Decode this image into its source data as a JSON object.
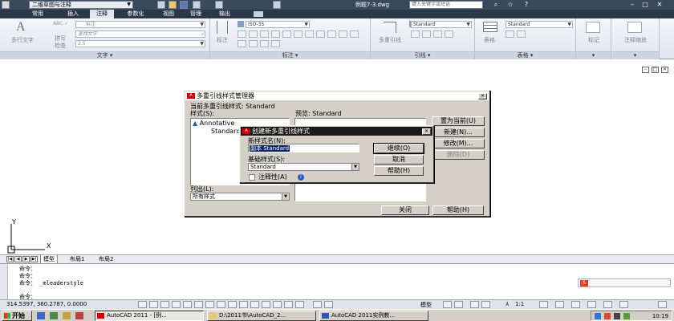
{
  "titlebar": {
    "workspace": "二维草图与注释",
    "document": "例题7-3.dwg",
    "search_placeholder": "键入关键字或短语"
  },
  "menu": {
    "tabs": [
      "常用",
      "插入",
      "注释",
      "参数化",
      "视图",
      "管理",
      "输出"
    ],
    "active": "注释"
  },
  "ribbon": {
    "text_panel": {
      "multiline_text": "多行文字",
      "spell_check_line1": "拼写",
      "spell_check_line2": "检查",
      "style_combo": "标注",
      "find_placeholder": "查找文字",
      "height_combo": "2.5",
      "title": "文字"
    },
    "dim_panel": {
      "dimension": "标注",
      "dimstyle_combo": "ISO-35",
      "title": "标注"
    },
    "leader_panel": {
      "multileader": "多重引线",
      "style_combo": "Standard",
      "title": "引线"
    },
    "table_panel": {
      "table": "表格",
      "style_combo": "Standard",
      "title": "表格"
    },
    "mark_panel": {
      "label": "标记"
    },
    "annoscale_panel": {
      "label_line1": "注释缩放"
    }
  },
  "layout_tabs": [
    "模型",
    "布局1",
    "布局2"
  ],
  "command_lines": [
    "命令：",
    "命令：",
    "命令：  _mleaderstyle",
    "",
    "命令："
  ],
  "status": {
    "coords": "314.5397,  360.2787, 0.0000",
    "model": "模型",
    "scale": "1:1",
    "clock": "10:19"
  },
  "taskbar": {
    "start": "开始",
    "tasks": [
      "AutoCAD 2011 - [例...",
      "D:\\2011书\\AutoCAD_2...",
      "AutoCAD 2011实例教..."
    ]
  },
  "mls_dialog": {
    "title": "多重引线样式管理器",
    "current_style": "当前多重引线样式: Standard",
    "styles_label": "样式(S):",
    "styles": [
      "Annotative",
      "Standard"
    ],
    "preview_label": "预览: Standard",
    "list_label": "列出(L):",
    "list_value": "所有样式",
    "btn_set_current": "置为当前(U)",
    "btn_new": "新建(N)...",
    "btn_modify": "修改(M)...",
    "btn_delete": "删除(D)",
    "btn_close": "关闭",
    "btn_help": "帮助(H)"
  },
  "new_dialog": {
    "title": "创建新多重引线样式",
    "name_label": "新样式名(N):",
    "name_value": "副本 Standard",
    "base_label": "基础样式(S):",
    "base_value": "Standard",
    "annotative_label": "注释性(A)",
    "btn_continue": "继续(O)",
    "btn_cancel": "取消",
    "btn_help": "帮助(H)"
  },
  "colors": {
    "title_active": "#1a1a1a",
    "ribbon_dark": "#2c3848",
    "selection": "#0a246a"
  }
}
